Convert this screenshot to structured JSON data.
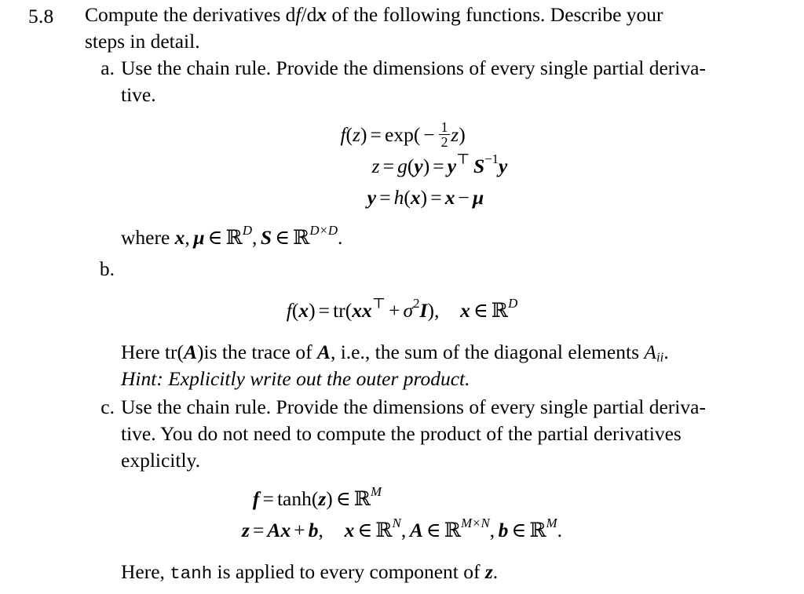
{
  "document": {
    "exercise_number": "5.8",
    "intro": {
      "line1": "Compute the derivatives",
      "derivative_notation": "df/dx",
      "line1_cont": "of the following functions. Describe your",
      "line2": "steps in detail."
    },
    "items": [
      {
        "letter": "a.",
        "text_line1": "Use the chain rule. Provide the dimensions of every single partial deriva-",
        "text_line2": "tive.",
        "equations": [
          "f(z) = exp(-1/2 z)",
          "z = g(y) = y^T S^-1 y",
          "y = h(x) = x - mu"
        ],
        "where_text": "where x, mu in R^D, S in R^{D x D}."
      },
      {
        "letter": "b.",
        "text_line1": "",
        "equations": [
          "f(x) = tr(x x^T + sigma^2 I),   x in R^D"
        ],
        "note_line1": "Here tr(A) is the trace of A, i.e., the sum of the diagonal elements A_ii.",
        "note_line2": "Hint: Explicitly write out the outer product."
      },
      {
        "letter": "c.",
        "text_line1": "Use the chain rule. Provide the dimensions of every single partial deriva-",
        "text_line2": "tive. You do not need to compute the product of the partial derivatives",
        "text_line3": "explicitly.",
        "equations": [
          "f = tanh(z) in R^M",
          "z = Ax + b,   x in R^N, A in R^{M x N}, b in R^M."
        ],
        "note_line1": "Here, tanh is applied to every component of z."
      }
    ],
    "words": {
      "where": "where",
      "here": "Here",
      "here_comma": "Here,",
      "is_the_trace_of": "is the trace of",
      "ie_sum": "i.e., the sum of the diagonal elements",
      "hint": "Hint: Explicitly write out the outer product.",
      "is_applied": "is applied to every component of",
      "tanh_mono": "tanh",
      "tr": "tr",
      "exp": "exp"
    },
    "colors": {
      "text": "#000000",
      "background": "#ffffff"
    }
  }
}
